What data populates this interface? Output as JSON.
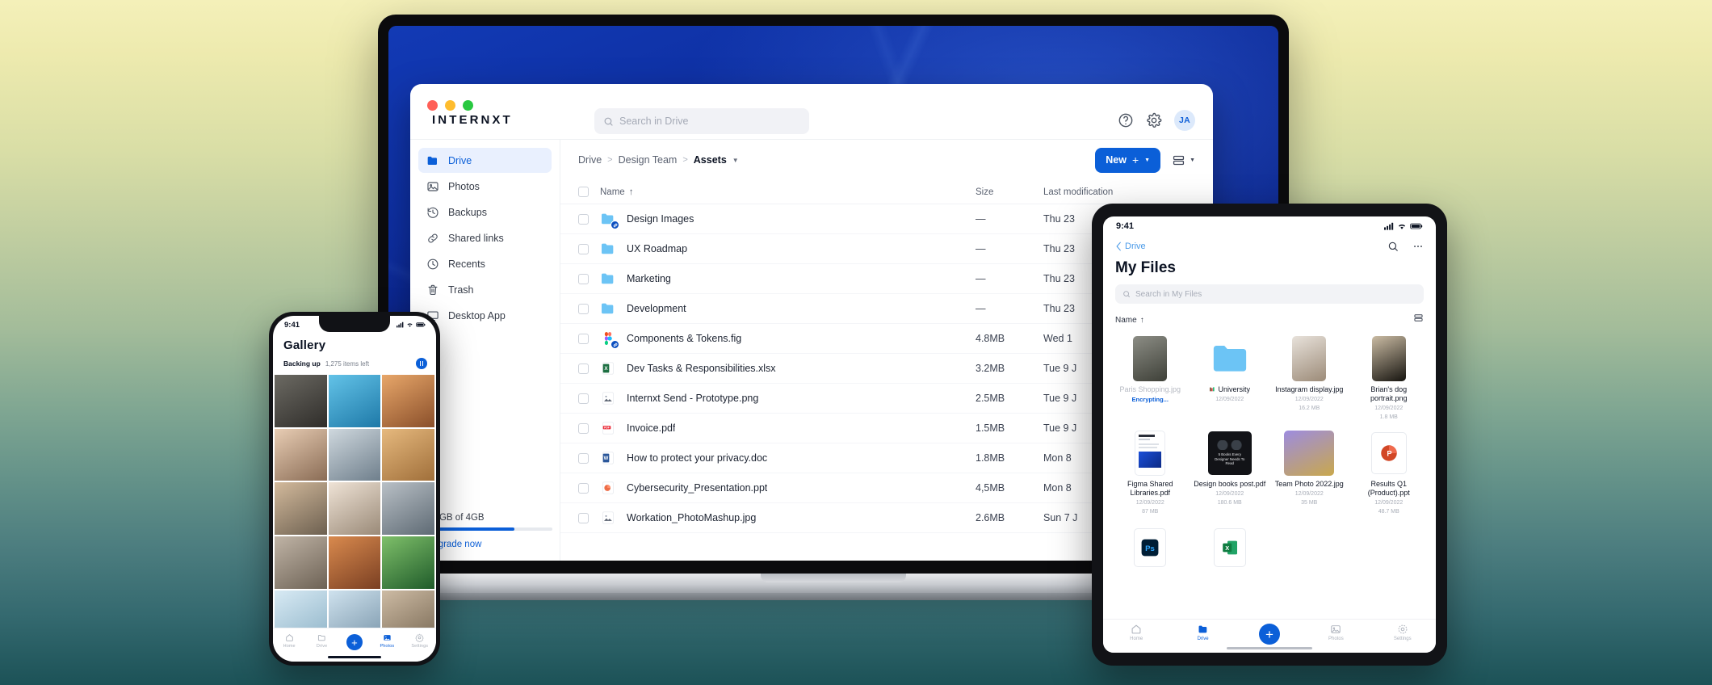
{
  "background": {
    "top_color": "#F4F0B9",
    "bottom_color": "#1C5257"
  },
  "desktop": {
    "brand": "INTERNXT",
    "search": {
      "placeholder": "Search in Drive"
    },
    "window_controls": [
      "close",
      "minimize",
      "maximize"
    ],
    "header_icons": [
      "help-icon",
      "gear-icon"
    ],
    "avatar_initials": "JA",
    "sidebar": {
      "items": [
        {
          "label": "Drive",
          "icon": "folder-icon",
          "active": true
        },
        {
          "label": "Photos",
          "icon": "image-icon",
          "active": false
        },
        {
          "label": "Backups",
          "icon": "history-icon",
          "active": false
        },
        {
          "label": "Shared links",
          "icon": "link-icon",
          "active": false
        },
        {
          "label": "Recents",
          "icon": "clock-icon",
          "active": false
        },
        {
          "label": "Trash",
          "icon": "trash-icon",
          "active": false
        },
        {
          "label": "Desktop App",
          "icon": "monitor-icon",
          "active": false
        }
      ],
      "storage_text": "2.8GB of 4GB",
      "storage_percent": 70,
      "upgrade_label": "Upgrade now"
    },
    "breadcrumb": {
      "root": "Drive",
      "middle": "Design Team",
      "current": "Assets"
    },
    "new_button": {
      "label": "New",
      "plus": "+"
    },
    "view_toggle": "list-view-icon",
    "table": {
      "columns": {
        "name": "Name",
        "size": "Size",
        "modified": "Last modification"
      },
      "sort_indicator": "↑",
      "rows": [
        {
          "name": "Design Images",
          "size": "—",
          "modified": "Thu 23",
          "icon": "folder-icon",
          "shared": true
        },
        {
          "name": "UX Roadmap",
          "size": "—",
          "modified": "Thu 23",
          "icon": "folder-icon",
          "shared": false
        },
        {
          "name": "Marketing",
          "size": "—",
          "modified": "Thu 23",
          "icon": "folder-icon",
          "shared": false
        },
        {
          "name": "Development",
          "size": "—",
          "modified": "Thu 23",
          "icon": "folder-icon",
          "shared": false
        },
        {
          "name": "Components & Tokens.fig",
          "size": "4.8MB",
          "modified": "Wed 1",
          "icon": "figma-icon",
          "shared": true
        },
        {
          "name": "Dev Tasks & Responsibilities.xlsx",
          "size": "3.2MB",
          "modified": "Tue 9 J",
          "icon": "excel-icon",
          "shared": false
        },
        {
          "name": "Internxt Send - Prototype.png",
          "size": "2.5MB",
          "modified": "Tue 9 J",
          "icon": "image-file-icon",
          "shared": false
        },
        {
          "name": "Invoice.pdf",
          "size": "1.5MB",
          "modified": "Tue 9 J",
          "icon": "pdf-icon",
          "shared": false
        },
        {
          "name": "How to protect your privacy.doc",
          "size": "1.8MB",
          "modified": "Mon 8",
          "icon": "word-icon",
          "shared": false
        },
        {
          "name": "Cybersecurity_Presentation.ppt",
          "size": "4,5MB",
          "modified": "Mon 8",
          "icon": "powerpoint-icon",
          "shared": false
        },
        {
          "name": "Workation_PhotoMashup.jpg",
          "size": "2.6MB",
          "modified": "Sun 7 J",
          "icon": "image-file-icon",
          "shared": false
        }
      ]
    }
  },
  "phone": {
    "status": {
      "time": "9:41",
      "icons": [
        "cellular-icon",
        "wifi-icon",
        "battery-icon"
      ]
    },
    "title": "Gallery",
    "backup": {
      "label": "Backing up",
      "detail": "1,275 items left",
      "action": "pause-button"
    },
    "tabs": [
      {
        "label": "Home",
        "icon": "home-icon",
        "active": false
      },
      {
        "label": "Drive",
        "icon": "folder-outline-icon",
        "active": false
      },
      {
        "label": "",
        "icon": "plus-fab-icon",
        "active": false
      },
      {
        "label": "Photos",
        "icon": "image-icon",
        "active": true
      },
      {
        "label": "Settings",
        "icon": "gear-icon",
        "active": false
      }
    ],
    "photo_tiles": [
      {
        "name": "camera-flatlay",
        "c1": "#6c6a63",
        "c2": "#2f2d2a"
      },
      {
        "name": "beach-palm-sky",
        "c1": "#63c3e8",
        "c2": "#1e79a8"
      },
      {
        "name": "palm-trees-sunset",
        "c1": "#e8a76a",
        "c2": "#8a4f2a"
      },
      {
        "name": "portrait-smiling-woman",
        "c1": "#e8cdb4",
        "c2": "#8a6c55"
      },
      {
        "name": "hiking-mountain",
        "c1": "#cfd8de",
        "c2": "#6f7f8c"
      },
      {
        "name": "desert-dunes",
        "c1": "#e6b97e",
        "c2": "#a06f3a"
      },
      {
        "name": "couple-outdoors",
        "c1": "#d3ba9c",
        "c2": "#6d6050"
      },
      {
        "name": "wedding-couple",
        "c1": "#efe3d6",
        "c2": "#9a8a78"
      },
      {
        "name": "street-architecture",
        "c1": "#b9c0c6",
        "c2": "#5e6a74"
      },
      {
        "name": "stone-wall",
        "c1": "#c0b4a6",
        "c2": "#6d6255"
      },
      {
        "name": "red-canyon",
        "c1": "#d98a4e",
        "c2": "#7a3f22"
      },
      {
        "name": "monstera-leaf",
        "c1": "#7fc06a",
        "c2": "#1f5b2a"
      },
      {
        "name": "snow-mountain",
        "c1": "#d8eaf4",
        "c2": "#8fb4c8"
      },
      {
        "name": "glacier-peak",
        "c1": "#cfe2ee",
        "c2": "#7b97ab"
      },
      {
        "name": "wooden-deck",
        "c1": "#cdbba4",
        "c2": "#7a6a55"
      }
    ]
  },
  "tablet": {
    "status": {
      "time": "9:41",
      "icons": [
        "cellular-icon",
        "wifi-icon",
        "battery-icon"
      ]
    },
    "back_label": "Drive",
    "nav_icons": [
      "search-icon",
      "more-icon"
    ],
    "title": "My Files",
    "search": {
      "placeholder": "Search in My Files"
    },
    "sort": {
      "label": "Name",
      "indicator": "↑"
    },
    "view_icon": "list-view-icon",
    "items": [
      {
        "name": "Paris Shopping.jpg",
        "date": "",
        "size": "",
        "status": "Encrypting...",
        "kind": "image",
        "muted": true,
        "c1": "#8c8d85",
        "c2": "#3e4038"
      },
      {
        "name": "University",
        "date": "12/09/2022",
        "size": "",
        "status": "",
        "kind": "folder",
        "muted": false,
        "badge": "books-icon"
      },
      {
        "name": "Instagram display.jpg",
        "date": "12/09/2022",
        "size": "16.2 MB",
        "status": "",
        "kind": "image",
        "muted": false,
        "c1": "#e8e2db",
        "c2": "#9c8b78"
      },
      {
        "name": "Brian's dog portrait.png",
        "date": "12/09/2022",
        "size": "1.8 MB",
        "status": "",
        "kind": "image",
        "muted": false,
        "c1": "#cbbca4",
        "c2": "#16140f"
      },
      {
        "name": "Figma Shared Libraries.pdf",
        "date": "12/09/2022",
        "size": "87 MB",
        "status": "",
        "kind": "doc-preview",
        "muted": false,
        "c1": "#ffffff",
        "c2": "#dfe3ea"
      },
      {
        "name": "Design books post.pdf",
        "date": "12/09/2022",
        "size": "180.6 MB",
        "status": "",
        "kind": "dark-poster",
        "muted": false,
        "c1": "#16171a",
        "c2": "#000000"
      },
      {
        "name": "Team Photo 2022.jpg",
        "date": "12/09/2022",
        "size": "35 MB",
        "status": "",
        "kind": "image",
        "muted": false,
        "c1": "#9d8ce0",
        "c2": "#c9a84c"
      },
      {
        "name": "Results Q1 (Product).ppt",
        "date": "12/09/2022",
        "size": "48.7 MB",
        "status": "",
        "kind": "ppt",
        "muted": false
      },
      {
        "name": "",
        "date": "",
        "size": "",
        "status": "",
        "kind": "ps",
        "muted": false
      },
      {
        "name": "",
        "date": "",
        "size": "",
        "status": "",
        "kind": "xls",
        "muted": false
      }
    ],
    "tabs": [
      {
        "label": "Home",
        "icon": "home-icon",
        "active": false
      },
      {
        "label": "Drive",
        "icon": "folder-icon",
        "active": true
      },
      {
        "label": "",
        "icon": "plus-fab-icon",
        "active": false
      },
      {
        "label": "Photos",
        "icon": "image-icon",
        "active": false
      },
      {
        "label": "Settings",
        "icon": "gear-icon",
        "active": false
      }
    ]
  }
}
